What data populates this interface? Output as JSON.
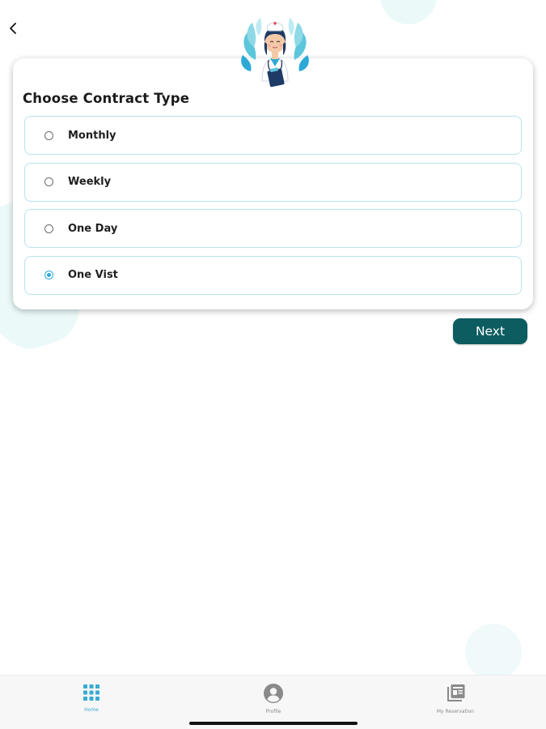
{
  "header": {
    "back_icon": "chevron-left-icon",
    "illustration": "nurse-illustration"
  },
  "contract": {
    "title": "Choose Contract Type",
    "options": [
      {
        "label": "Monthly",
        "selected": false
      },
      {
        "label": "Weekly",
        "selected": false
      },
      {
        "label": "One Day",
        "selected": false
      },
      {
        "label": "One Vist",
        "selected": true
      }
    ],
    "next_label": "Next"
  },
  "tab_bar": {
    "tabs": [
      {
        "label": "Home",
        "icon": "grid-icon",
        "active": true
      },
      {
        "label": "Profile",
        "icon": "user-circle-icon",
        "active": false
      },
      {
        "label": "My Reservation",
        "icon": "newspaper-icon",
        "active": false
      }
    ]
  },
  "colors": {
    "primary_button": "#0c5c60",
    "accent": "#2ea9d6",
    "option_border": "#b6e4ee",
    "active_tab": "#3aaad4",
    "inactive_tab": "#8a8a8a"
  }
}
